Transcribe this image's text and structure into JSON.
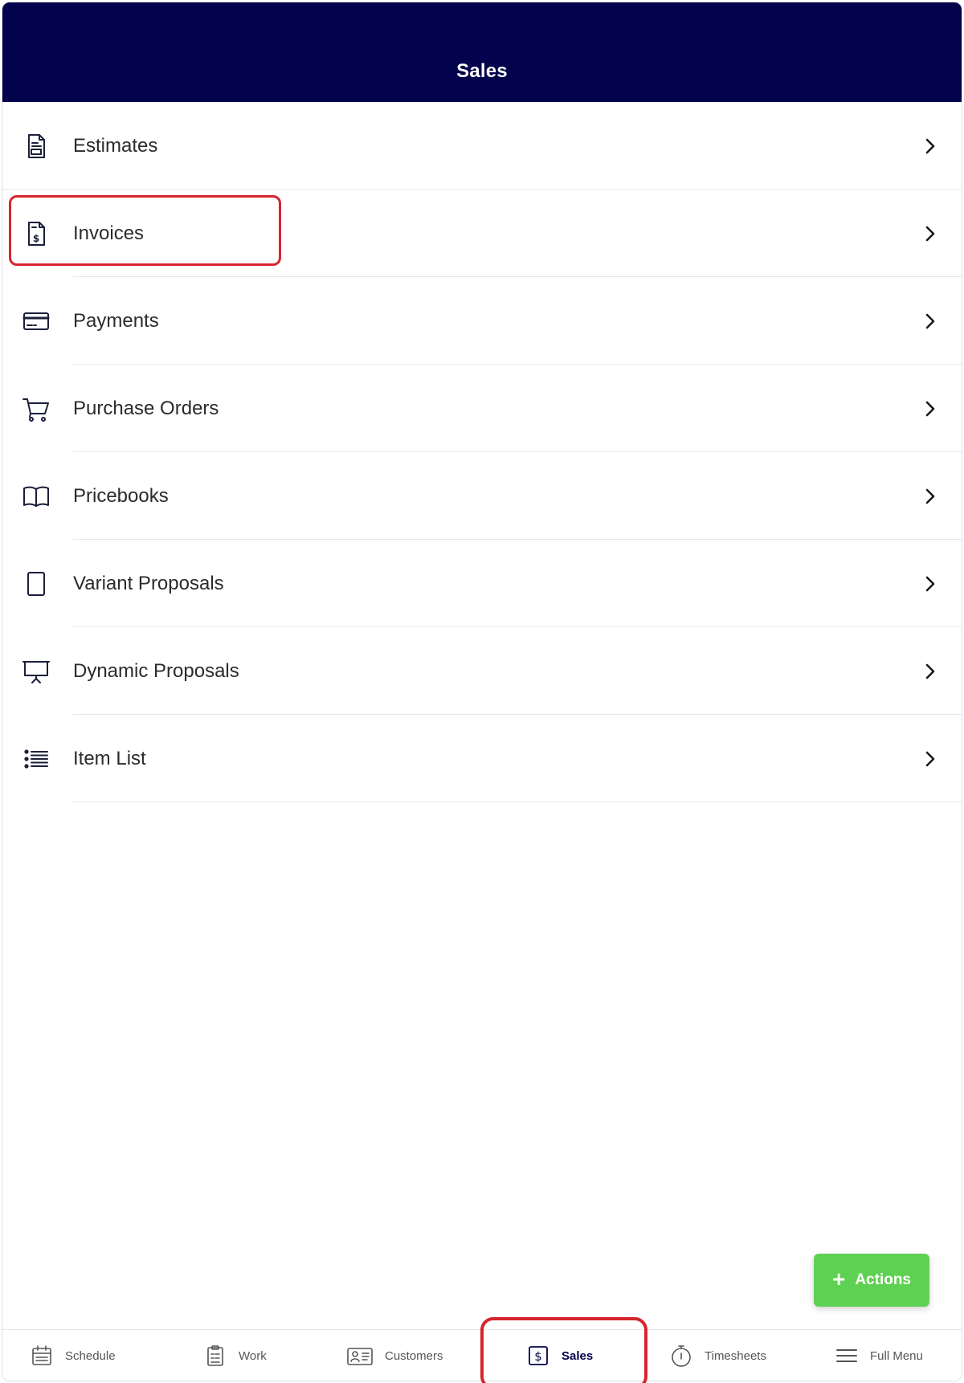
{
  "header": {
    "title": "Sales"
  },
  "menu": {
    "items": [
      {
        "label": "Estimates",
        "icon": "estimate-document-icon"
      },
      {
        "label": "Invoices",
        "icon": "invoice-document-icon"
      },
      {
        "label": "Payments",
        "icon": "credit-card-icon"
      },
      {
        "label": "Purchase Orders",
        "icon": "shopping-cart-icon"
      },
      {
        "label": "Pricebooks",
        "icon": "open-book-icon"
      },
      {
        "label": "Variant Proposals",
        "icon": "tablet-icon"
      },
      {
        "label": "Dynamic Proposals",
        "icon": "presentation-board-icon"
      },
      {
        "label": "Item List",
        "icon": "list-icon"
      }
    ]
  },
  "fab": {
    "label": "Actions",
    "plus": "+"
  },
  "tabs": [
    {
      "label": "Schedule",
      "icon": "calendar-icon"
    },
    {
      "label": "Work",
      "icon": "clipboard-icon"
    },
    {
      "label": "Customers",
      "icon": "contact-card-icon"
    },
    {
      "label": "Sales",
      "icon": "dollar-icon",
      "active": true
    },
    {
      "label": "Timesheets",
      "icon": "stopwatch-icon"
    },
    {
      "label": "Full Menu",
      "icon": "hamburger-menu-icon"
    }
  ],
  "colors": {
    "header_bg": "#03024c",
    "accent_navy": "#03024c",
    "actions_green": "#5fd152",
    "highlight_red": "#d6252e"
  }
}
